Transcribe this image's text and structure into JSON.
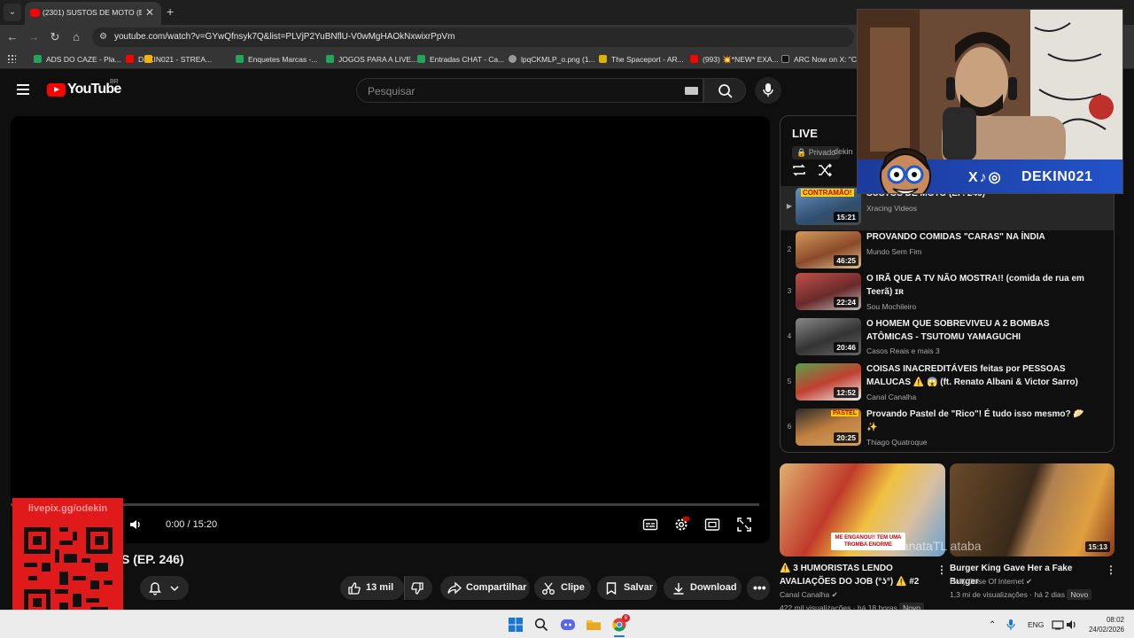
{
  "browser": {
    "tab_title": "(2301) SUSTOS DE MOTO (EP. 2",
    "url": "youtube.com/watch?v=GYwQfnsyk7Q&list=PLVjP2YuBNflU-V0wMgHAOkNxwixrPpVm",
    "bookmarks": [
      {
        "label": "ADS DO CAZE - Pla...",
        "color": "#22a45a"
      },
      {
        "label": "DEKIN021 - STREA...",
        "color": "#ff0000"
      },
      {
        "label": "Enquetes Marcas -...",
        "color": "#22a45a"
      },
      {
        "label": "JOGOS PARA A LIVE...",
        "color": "#22a45a"
      },
      {
        "label": "Entradas CHAT - Ca...",
        "color": "#22a45a"
      },
      {
        "label": "lpqCKMLP_o.png (1...",
        "color": "#9a9a9a"
      },
      {
        "label": "The Spaceport - AR...",
        "color": "#d8b400"
      },
      {
        "label": "(993) 💥*NEW* EXA...",
        "color": "#ff0000"
      },
      {
        "label": "ARC Now on X: \"Co...",
        "color": "#111111"
      }
    ]
  },
  "youtube": {
    "logo_text": "YouTube",
    "country": "BR",
    "search_placeholder": "Pesquisar"
  },
  "player": {
    "time": "0:00 / 15:20",
    "title": "S (EP. 246)"
  },
  "actions": {
    "likes": "13 mil",
    "share": "Compartilhar",
    "clip": "Clipe",
    "save": "Salvar",
    "download": "Download"
  },
  "playlist": {
    "title": "LIVE",
    "privacy": "Privado",
    "owner": "dekin",
    "items": [
      {
        "num": "▶",
        "title": "SUSTOS DE MOTO (EP. 246)",
        "channel": "Xracing Videos",
        "duration": "15:21",
        "thumb_color": "#4a6fa5",
        "thumb_label": "CONTRAMÃO!"
      },
      {
        "num": "2",
        "title": "PROVANDO COMIDAS \"CARAS\" NA ÍNDIA",
        "channel": "Mundo Sem Fim",
        "duration": "46:25",
        "thumb_color": "#b06a3b",
        "thumb_label": ""
      },
      {
        "num": "3",
        "title": "O IRÃ QUE A TV NÃO MOSTRA!! (comida de rua em Teerã) ɪʀ",
        "channel": "Sou Mochileiro",
        "duration": "22:24",
        "thumb_color": "#8a3a2a",
        "thumb_label": ""
      },
      {
        "num": "4",
        "title": "O HOMEM QUE SOBREVIVEU A 2 BOMBAS ATÔMICAS - TSUTOMU YAMAGUCHI",
        "channel": "Casos Reais e mais 3",
        "duration": "20:46",
        "thumb_color": "#4a4a4a",
        "thumb_label": ""
      },
      {
        "num": "5",
        "title": "COISAS INACREDITÁVEIS feitas por PESSOAS MALUCAS ⚠️ 😱 (ft. Renato Albani & Victor Sarro)",
        "channel": "Canal Canalha",
        "duration": "12:52",
        "thumb_color": "#3f7d3a",
        "thumb_label": ""
      },
      {
        "num": "6",
        "title": "Provando Pastel de \"Rico\"! É tudo isso mesmo? 🥟 ✨",
        "channel": "Thiago Quatroque",
        "duration": "20:25",
        "thumb_color": "#8a5a2a",
        "thumb_label": "PASTEL"
      }
    ]
  },
  "recommendations": [
    {
      "title": "⚠️ 3 HUMORISTAS LENDO AVALIAÇÕES DO JOB (°ʖ°) ⚠️ #2",
      "channel": "Canal Canalha",
      "views": "422 mil visualizações",
      "age": "há 18 horas",
      "badge": "Novo",
      "thumb_text": "ME ENGANOU!! TEM UMA TROMBA ENORME",
      "duration": ""
    },
    {
      "title": "Burger King Gave Her a Fake Burger",
      "channel": "Daily Dose Of Internet",
      "views": "1,3 mi de visualizações",
      "age": "há 2 dias",
      "badge": "Novo",
      "thumb_text": "",
      "duration": "15:13"
    }
  ],
  "overlay": {
    "cam_handle": "DEKIN021",
    "social_icons": "X♪◎",
    "qr_label": "livepix.gg/odekin",
    "watermark": "LanataTL ataba"
  },
  "taskbar": {
    "lang": "ENG",
    "time": "08:02",
    "date": "24/02/2026",
    "notif": "6"
  }
}
